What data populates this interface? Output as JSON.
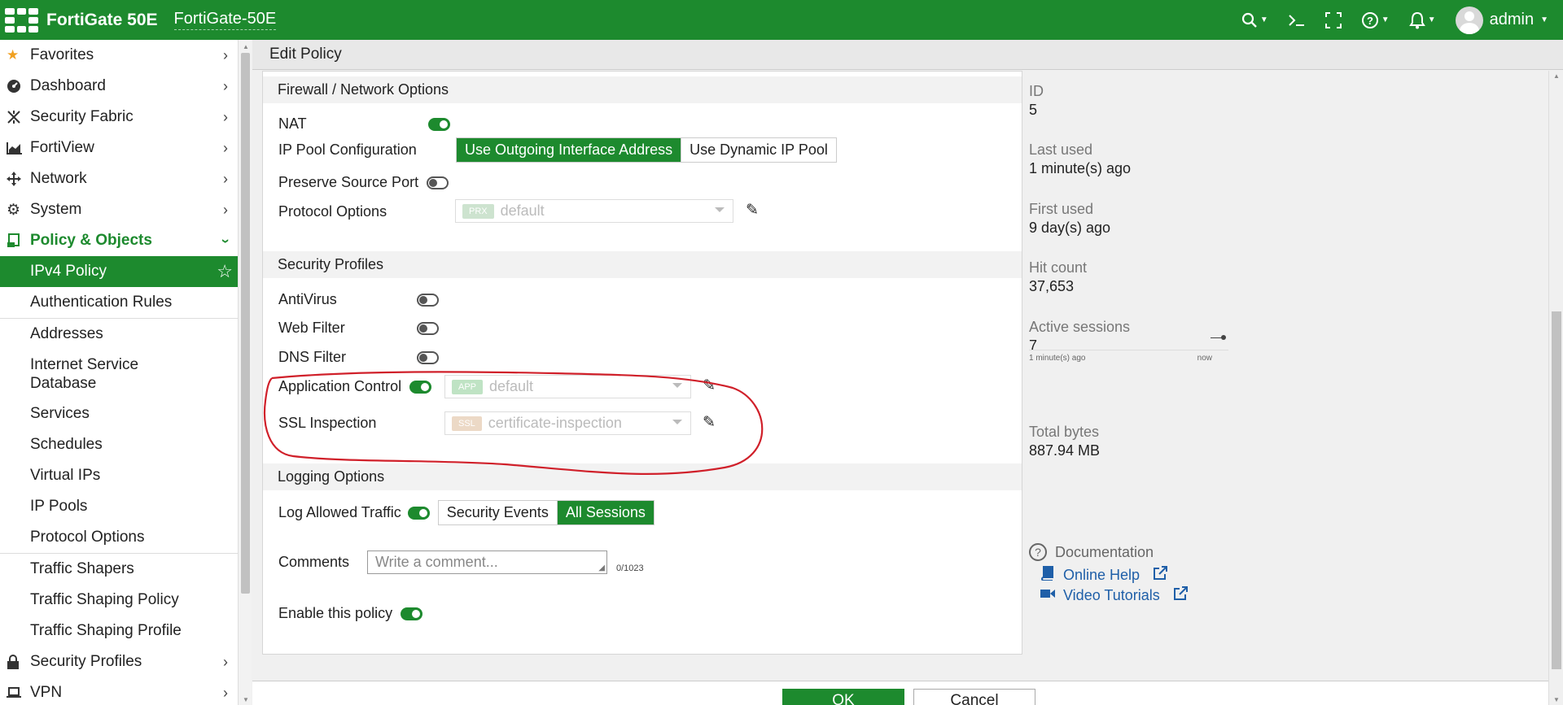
{
  "topbar": {
    "product": "FortiGate 50E",
    "hostname": "FortiGate-50E",
    "user": "admin",
    "icons": [
      "search-icon",
      "cli-console-icon",
      "fullscreen-icon",
      "help-icon",
      "bell-icon"
    ]
  },
  "sidebar": {
    "items": [
      {
        "label": "Favorites",
        "icon": "star-icon"
      },
      {
        "label": "Dashboard",
        "icon": "dashboard-icon"
      },
      {
        "label": "Security Fabric",
        "icon": "fabric-icon"
      },
      {
        "label": "FortiView",
        "icon": "chart-icon"
      },
      {
        "label": "Network",
        "icon": "network-icon"
      },
      {
        "label": "System",
        "icon": "gear-icon"
      },
      {
        "label": "Policy & Objects",
        "icon": "policy-icon"
      }
    ],
    "sub_items": {
      "ipv4_policy": "IPv4 Policy",
      "authentication_rules": "Authentication Rules",
      "addresses": "Addresses",
      "internet_service_database": "Internet Service Database",
      "services": "Services",
      "schedules": "Schedules",
      "virtual_ips": "Virtual IPs",
      "ip_pools": "IP Pools",
      "protocol_options": "Protocol Options",
      "traffic_shapers": "Traffic Shapers",
      "traffic_shaping_policy": "Traffic Shaping Policy",
      "traffic_shaping_profile": "Traffic Shaping Profile"
    },
    "bottom_items": [
      {
        "label": "Security Profiles",
        "icon": "lock-icon"
      },
      {
        "label": "VPN",
        "icon": "laptop-icon"
      }
    ]
  },
  "page": {
    "title": "Edit Policy"
  },
  "firewall": {
    "section_title": "Firewall / Network Options",
    "nat_label": "NAT",
    "nat_enabled": true,
    "ip_pool_label": "IP Pool Configuration",
    "ip_pool_options": [
      "Use Outgoing Interface Address",
      "Use Dynamic IP Pool"
    ],
    "ip_pool_selected": "Use Outgoing Interface Address",
    "preserve_label": "Preserve Source Port",
    "preserve_enabled": false,
    "protocol_label": "Protocol Options",
    "protocol_tag": "PRX",
    "protocol_value": "default"
  },
  "security": {
    "section_title": "Security Profiles",
    "antivirus_label": "AntiVirus",
    "webfilter_label": "Web Filter",
    "dnsfilter_label": "DNS Filter",
    "appcontrol_label": "Application Control",
    "appcontrol_tag": "APP",
    "appcontrol_value": "default",
    "ssl_label": "SSL Inspection",
    "ssl_tag": "SSL",
    "ssl_value": "certificate-inspection"
  },
  "logging": {
    "section_title": "Logging Options",
    "log_label": "Log Allowed Traffic",
    "log_enabled": true,
    "options": [
      "Security Events",
      "All Sessions"
    ],
    "selected": "All Sessions",
    "comments_label": "Comments",
    "comments_placeholder": "Write a comment...",
    "comments_count": "0/1023",
    "enable_label": "Enable this policy",
    "enable_enabled": true
  },
  "info": {
    "id_label": "ID",
    "id_value": "5",
    "last_used_label": "Last used",
    "last_used_value": "1 minute(s) ago",
    "first_used_label": "First used",
    "first_used_value": "9 day(s) ago",
    "hit_count_label": "Hit count",
    "hit_count_value": "37,653",
    "active_sessions_label": "Active sessions",
    "active_sessions_value": "7",
    "spark_left": "1 minute(s) ago",
    "spark_right": "now",
    "total_bytes_label": "Total bytes",
    "total_bytes_value": "887.94 MB"
  },
  "documentation": {
    "title": "Documentation",
    "links": [
      "Online Help",
      "Video Tutorials"
    ]
  },
  "footer": {
    "ok": "OK",
    "cancel": "Cancel"
  },
  "colors": {
    "brand_green": "#1d8a2e",
    "link_blue": "#1f5fa8",
    "annotation_red": "#d0202a"
  }
}
